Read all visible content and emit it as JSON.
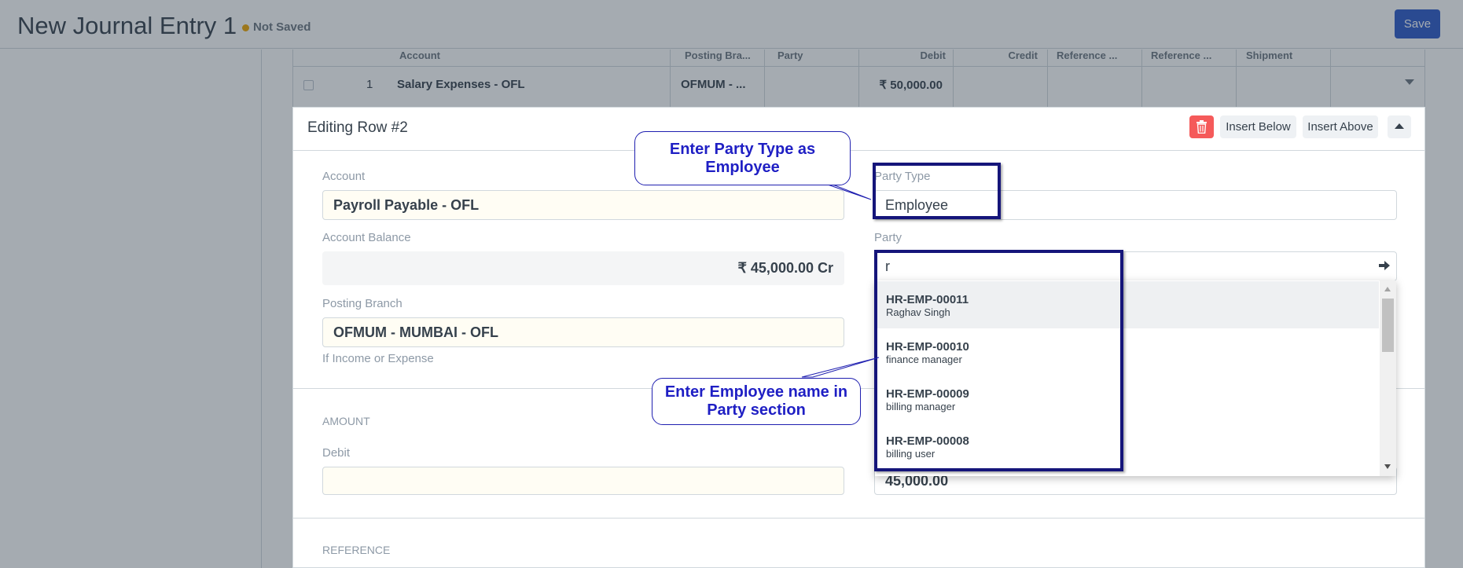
{
  "header": {
    "title": "New Journal Entry 1",
    "status": "Not Saved",
    "save_label": "Save"
  },
  "grid": {
    "columns": [
      "Account",
      "Posting Bra...",
      "Party",
      "Debit",
      "Credit",
      "Reference ...",
      "Reference ...",
      "Shipment"
    ],
    "row": {
      "index": "1",
      "account": "Salary Expenses - OFL",
      "posting_branch": "OFMUM - ...",
      "debit": "₹ 50,000.00"
    }
  },
  "editor": {
    "title": "Editing Row #2",
    "insert_below": "Insert Below",
    "insert_above": "Insert Above",
    "account_label": "Account",
    "account_value": "Payroll Payable - OFL",
    "party_type_label": "Party Type",
    "party_type_value": "Employee",
    "account_balance_label": "Account Balance",
    "account_balance_value": "₹ 45,000.00 Cr",
    "party_label": "Party",
    "party_value": "r",
    "posting_branch_label": "Posting Branch",
    "posting_branch_value": "OFMUM - MUMBAI - OFL",
    "posting_branch_help": "If Income or Expense",
    "amount_section": "AMOUNT",
    "debit_label": "Debit",
    "debit_value": "",
    "credit_value": "45,000.00",
    "reference_section": "REFERENCE"
  },
  "party_options": [
    {
      "id": "HR-EMP-00011",
      "name": "Raghav Singh"
    },
    {
      "id": "HR-EMP-00010",
      "name": "finance manager"
    },
    {
      "id": "HR-EMP-00009",
      "name": "billing manager"
    },
    {
      "id": "HR-EMP-00008",
      "name": "billing user"
    }
  ],
  "annotations": {
    "party_type_note": "Enter Party Type as Employee",
    "party_note": "Enter Employee name in Party section"
  },
  "colors": {
    "primary": "#2b58c8",
    "danger": "#f55a5a",
    "annotation": "#1f1fc4",
    "highlight_border": "#15157a"
  },
  "icons": [
    "trash-icon",
    "caret-up-icon",
    "go-arrow-icon",
    "chevron-down-icon"
  ]
}
